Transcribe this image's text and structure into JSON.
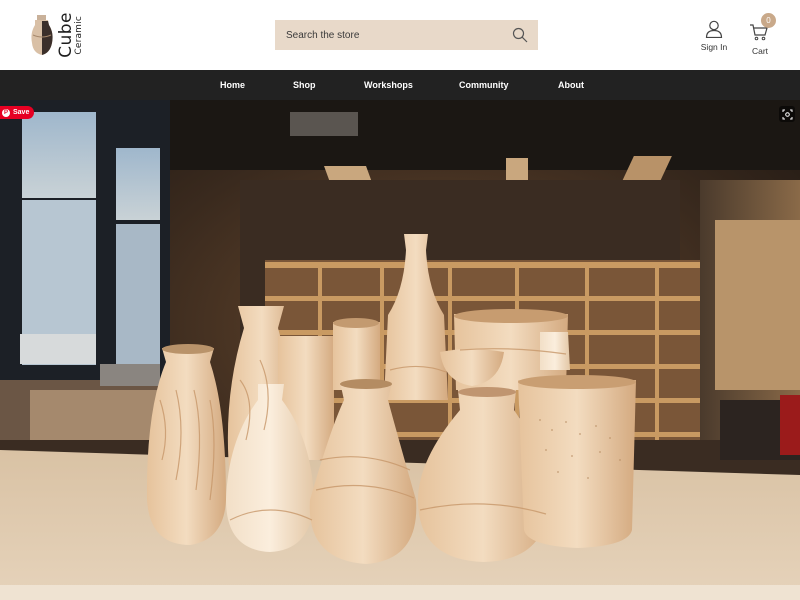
{
  "brand": {
    "line1": "Ceramic",
    "line2": "Cube"
  },
  "search": {
    "placeholder": "Search the store",
    "icon": "search-icon"
  },
  "actions": {
    "signin_label": "Sign In",
    "cart_label": "Cart",
    "cart_count": "0"
  },
  "nav": {
    "items": [
      "Home",
      "Shop",
      "Workshops",
      "Community",
      "About"
    ]
  },
  "hero": {
    "save_label": "Save",
    "image": "ceramic vases on table in pottery studio"
  },
  "colors": {
    "nav_bg": "#222222",
    "search_bg": "#e8d9c9",
    "accent": "#c9a98a",
    "pin_red": "#e60023"
  }
}
